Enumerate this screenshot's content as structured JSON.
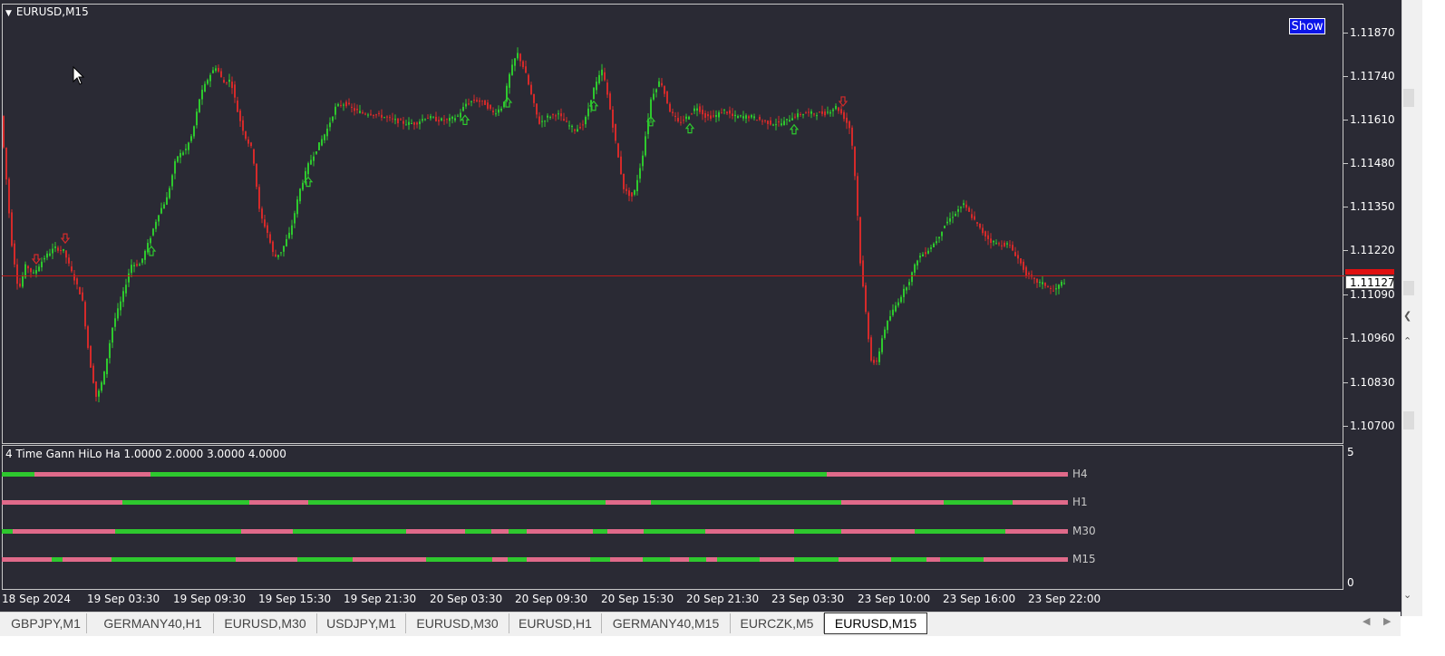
{
  "window": {
    "symbol_title": "EURUSD,M15",
    "show_button_label": "Show",
    "current_price": "1.11127",
    "indicator_title": "4 Time Gann HiLo Ha 1.0000 2.0000 3.0000 4.0000"
  },
  "price_axis": [
    "1.11870",
    "1.11740",
    "1.11610",
    "1.11480",
    "1.11350",
    "1.11220",
    "1.11090",
    "1.10960",
    "1.10830",
    "1.10700"
  ],
  "indicator_axis": {
    "max": "5",
    "min": "0"
  },
  "time_axis": [
    "18 Sep 2024",
    "19 Sep 03:30",
    "19 Sep 09:30",
    "19 Sep 15:30",
    "19 Sep 21:30",
    "20 Sep 03:30",
    "20 Sep 09:30",
    "20 Sep 15:30",
    "20 Sep 21:30",
    "23 Sep 03:30",
    "23 Sep 10:00",
    "23 Sep 16:00",
    "23 Sep 22:00"
  ],
  "hilo_rows": [
    {
      "label": "H4",
      "segments": [
        [
          "g",
          0,
          36
        ],
        [
          "p",
          36,
          164
        ],
        [
          "g",
          164,
          910
        ],
        [
          "p",
          910,
          1176
        ]
      ]
    },
    {
      "label": "H1",
      "segments": [
        [
          "p",
          0,
          133
        ],
        [
          "g",
          133,
          273
        ],
        [
          "p",
          273,
          338
        ],
        [
          "g",
          338,
          666
        ],
        [
          "p",
          666,
          716
        ],
        [
          "g",
          716,
          926
        ],
        [
          "p",
          926,
          1039
        ],
        [
          "g",
          1039,
          1115
        ],
        [
          "p",
          1115,
          1176
        ]
      ]
    },
    {
      "label": "M30",
      "segments": [
        [
          "g",
          0,
          12
        ],
        [
          "p",
          12,
          125
        ],
        [
          "g",
          125,
          264
        ],
        [
          "p",
          264,
          321
        ],
        [
          "g",
          321,
          446
        ],
        [
          "p",
          446,
          511
        ],
        [
          "g",
          511,
          540
        ],
        [
          "p",
          540,
          559
        ],
        [
          "g",
          559,
          579
        ],
        [
          "p",
          579,
          652
        ],
        [
          "g",
          652,
          668
        ],
        [
          "p",
          668,
          708
        ],
        [
          "g",
          708,
          776
        ],
        [
          "p",
          776,
          874
        ],
        [
          "g",
          874,
          926
        ],
        [
          "p",
          926,
          1007
        ],
        [
          "g",
          1007,
          1107
        ],
        [
          "p",
          1107,
          1176
        ]
      ]
    },
    {
      "label": "M15",
      "segments": [
        [
          "p",
          0,
          55
        ],
        [
          "g",
          55,
          67
        ],
        [
          "p",
          67,
          121
        ],
        [
          "g",
          121,
          258
        ],
        [
          "p",
          258,
          326
        ],
        [
          "g",
          326,
          387
        ],
        [
          "p",
          387,
          468
        ],
        [
          "g",
          468,
          541
        ],
        [
          "p",
          541,
          558
        ],
        [
          "g",
          558,
          579
        ],
        [
          "p",
          579,
          649
        ],
        [
          "g",
          649,
          671
        ],
        [
          "p",
          671,
          707
        ],
        [
          "g",
          707,
          737
        ],
        [
          "p",
          737,
          758
        ],
        [
          "g",
          758,
          777
        ],
        [
          "p",
          777,
          789
        ],
        [
          "g",
          789,
          836
        ],
        [
          "p",
          836,
          874
        ],
        [
          "g",
          874,
          923
        ],
        [
          "p",
          923,
          981
        ],
        [
          "g",
          981,
          1020
        ],
        [
          "p",
          1020,
          1035
        ],
        [
          "g",
          1035,
          1083
        ],
        [
          "p",
          1083,
          1176
        ]
      ]
    }
  ],
  "tabs": [
    {
      "label": "GBPJPY,M1",
      "active": false
    },
    {
      "label": "GERMANY40,H1",
      "active": false
    },
    {
      "label": "EURUSD,M30",
      "active": false
    },
    {
      "label": "USDJPY,M1",
      "active": false
    },
    {
      "label": "EURUSD,M30",
      "active": false
    },
    {
      "label": "EURUSD,H1",
      "active": false
    },
    {
      "label": "GERMANY40,M15",
      "active": false
    },
    {
      "label": "EURCZK,M5",
      "active": false
    },
    {
      "label": "EURUSD,M15",
      "active": true
    }
  ],
  "chart_data": {
    "type": "candlestick",
    "symbol": "EURUSD",
    "timeframe": "M15",
    "y_range": [
      1.1065,
      1.1192
    ],
    "current_price": 1.11127,
    "path": [
      [
        0,
        1.117
      ],
      [
        8,
        1.1145
      ],
      [
        14,
        1.1125
      ],
      [
        22,
        1.111
      ],
      [
        30,
        1.1118
      ],
      [
        38,
        1.1115
      ],
      [
        50,
        1.112
      ],
      [
        62,
        1.1123
      ],
      [
        72,
        1.1122
      ],
      [
        80,
        1.1116
      ],
      [
        92,
        1.1108
      ],
      [
        100,
        1.109
      ],
      [
        108,
        1.1078
      ],
      [
        116,
        1.1085
      ],
      [
        126,
        1.11
      ],
      [
        136,
        1.1108
      ],
      [
        146,
        1.1118
      ],
      [
        156,
        1.1118
      ],
      [
        166,
        1.1125
      ],
      [
        176,
        1.1133
      ],
      [
        186,
        1.1138
      ],
      [
        196,
        1.115
      ],
      [
        206,
        1.1152
      ],
      [
        214,
        1.1157
      ],
      [
        222,
        1.1168
      ],
      [
        232,
        1.1174
      ],
      [
        240,
        1.1177
      ],
      [
        248,
        1.1172
      ],
      [
        256,
        1.1173
      ],
      [
        264,
        1.1163
      ],
      [
        272,
        1.1156
      ],
      [
        280,
        1.1152
      ],
      [
        288,
        1.1133
      ],
      [
        296,
        1.1128
      ],
      [
        304,
        1.112
      ],
      [
        312,
        1.1122
      ],
      [
        322,
        1.1128
      ],
      [
        332,
        1.114
      ],
      [
        342,
        1.1148
      ],
      [
        352,
        1.1153
      ],
      [
        362,
        1.1158
      ],
      [
        372,
        1.1165
      ],
      [
        382,
        1.1166
      ],
      [
        392,
        1.1164
      ],
      [
        402,
        1.1163
      ],
      [
        412,
        1.1163
      ],
      [
        424,
        1.1162
      ],
      [
        436,
        1.1161
      ],
      [
        448,
        1.116
      ],
      [
        460,
        1.116
      ],
      [
        472,
        1.1162
      ],
      [
        484,
        1.1161
      ],
      [
        496,
        1.1161
      ],
      [
        506,
        1.1162
      ],
      [
        516,
        1.1166
      ],
      [
        526,
        1.1167
      ],
      [
        536,
        1.1166
      ],
      [
        546,
        1.1163
      ],
      [
        556,
        1.1165
      ],
      [
        564,
        1.1175
      ],
      [
        572,
        1.1181
      ],
      [
        580,
        1.1176
      ],
      [
        588,
        1.1168
      ],
      [
        596,
        1.116
      ],
      [
        606,
        1.1162
      ],
      [
        616,
        1.1163
      ],
      [
        626,
        1.116
      ],
      [
        636,
        1.1158
      ],
      [
        646,
        1.116
      ],
      [
        656,
        1.117
      ],
      [
        666,
        1.1176
      ],
      [
        674,
        1.1165
      ],
      [
        682,
        1.1152
      ],
      [
        690,
        1.114
      ],
      [
        700,
        1.1138
      ],
      [
        710,
        1.115
      ],
      [
        720,
        1.1168
      ],
      [
        730,
        1.1173
      ],
      [
        740,
        1.1164
      ],
      [
        750,
        1.116
      ],
      [
        760,
        1.1162
      ],
      [
        770,
        1.1165
      ],
      [
        780,
        1.1162
      ],
      [
        790,
        1.1162
      ],
      [
        800,
        1.1164
      ],
      [
        810,
        1.1162
      ],
      [
        820,
        1.1162
      ],
      [
        830,
        1.1162
      ],
      [
        840,
        1.1161
      ],
      [
        852,
        1.116
      ],
      [
        864,
        1.116
      ],
      [
        876,
        1.1162
      ],
      [
        888,
        1.1163
      ],
      [
        900,
        1.1163
      ],
      [
        912,
        1.1163
      ],
      [
        924,
        1.1165
      ],
      [
        932,
        1.1162
      ],
      [
        940,
        1.1158
      ],
      [
        946,
        1.114
      ],
      [
        950,
        1.112
      ],
      [
        956,
        1.1105
      ],
      [
        962,
        1.109
      ],
      [
        968,
        1.1088
      ],
      [
        976,
        1.1098
      ],
      [
        984,
        1.1103
      ],
      [
        994,
        1.1108
      ],
      [
        1004,
        1.1113
      ],
      [
        1014,
        1.112
      ],
      [
        1024,
        1.1122
      ],
      [
        1034,
        1.1125
      ],
      [
        1044,
        1.113
      ],
      [
        1054,
        1.1133
      ],
      [
        1064,
        1.1136
      ],
      [
        1074,
        1.1132
      ],
      [
        1084,
        1.1128
      ],
      [
        1094,
        1.1125
      ],
      [
        1104,
        1.1124
      ],
      [
        1114,
        1.1124
      ],
      [
        1124,
        1.112
      ],
      [
        1134,
        1.1115
      ],
      [
        1144,
        1.1113
      ],
      [
        1154,
        1.1112
      ],
      [
        1164,
        1.111
      ],
      [
        1174,
        1.1113
      ]
    ],
    "buy_arrow_x": [
      167,
      340,
      513,
      560,
      655,
      718,
      761,
      876
    ],
    "sell_arrow_x": [
      40,
      72,
      930
    ]
  }
}
